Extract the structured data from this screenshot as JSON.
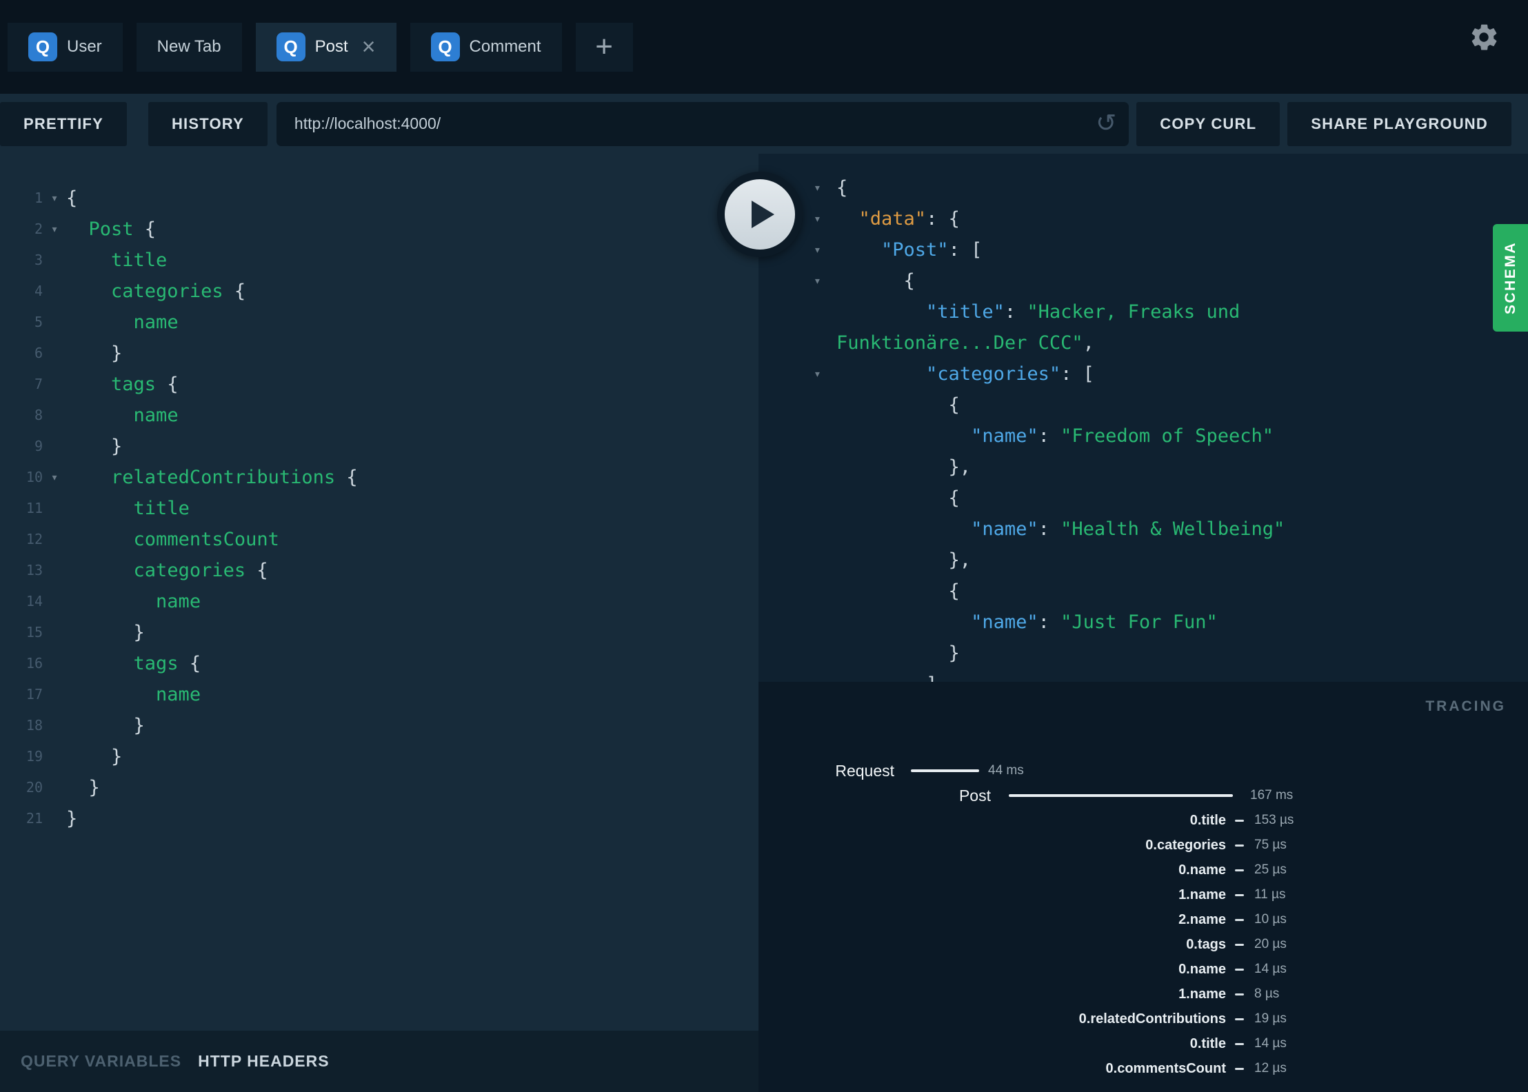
{
  "tabs": {
    "items": [
      {
        "label": "User",
        "type": "query",
        "active": false,
        "closable": false
      },
      {
        "label": "New Tab",
        "type": "plain",
        "active": false,
        "closable": false
      },
      {
        "label": "Post",
        "type": "query",
        "active": true,
        "closable": true
      },
      {
        "label": "Comment",
        "type": "query",
        "active": false,
        "closable": false
      }
    ]
  },
  "icons": {
    "query_badge": "Q",
    "close": "×",
    "plus": "+",
    "reload": "↺",
    "fold": "▾"
  },
  "toolbar": {
    "prettify_label": "PRETTIFY",
    "history_label": "HISTORY",
    "endpoint_value": "http://localhost:4000/",
    "copy_curl_label": "COPY CURL",
    "share_label": "SHARE PLAYGROUND"
  },
  "editor": {
    "lines": [
      {
        "num": 1,
        "fold": true,
        "tokens": [
          [
            "p",
            "{"
          ]
        ]
      },
      {
        "num": 2,
        "fold": true,
        "tokens": [
          [
            "p",
            "  "
          ],
          [
            "f",
            "Post"
          ],
          [
            "p",
            " {"
          ]
        ]
      },
      {
        "num": 3,
        "fold": false,
        "tokens": [
          [
            "p",
            "    "
          ],
          [
            "f",
            "title"
          ]
        ]
      },
      {
        "num": 4,
        "fold": false,
        "tokens": [
          [
            "p",
            "    "
          ],
          [
            "f",
            "categories"
          ],
          [
            "p",
            " {"
          ]
        ]
      },
      {
        "num": 5,
        "fold": false,
        "tokens": [
          [
            "p",
            "      "
          ],
          [
            "f",
            "name"
          ]
        ]
      },
      {
        "num": 6,
        "fold": false,
        "tokens": [
          [
            "p",
            "    }"
          ]
        ]
      },
      {
        "num": 7,
        "fold": false,
        "tokens": [
          [
            "p",
            "    "
          ],
          [
            "f",
            "tags"
          ],
          [
            "p",
            " {"
          ]
        ]
      },
      {
        "num": 8,
        "fold": false,
        "tokens": [
          [
            "p",
            "      "
          ],
          [
            "f",
            "name"
          ]
        ]
      },
      {
        "num": 9,
        "fold": false,
        "tokens": [
          [
            "p",
            "    }"
          ]
        ]
      },
      {
        "num": 10,
        "fold": true,
        "tokens": [
          [
            "p",
            "    "
          ],
          [
            "f",
            "relatedContributions"
          ],
          [
            "p",
            " {"
          ]
        ]
      },
      {
        "num": 11,
        "fold": false,
        "tokens": [
          [
            "p",
            "      "
          ],
          [
            "f",
            "title"
          ]
        ]
      },
      {
        "num": 12,
        "fold": false,
        "tokens": [
          [
            "p",
            "      "
          ],
          [
            "f",
            "commentsCount"
          ]
        ]
      },
      {
        "num": 13,
        "fold": false,
        "tokens": [
          [
            "p",
            "      "
          ],
          [
            "f",
            "categories"
          ],
          [
            "p",
            " {"
          ]
        ]
      },
      {
        "num": 14,
        "fold": false,
        "tokens": [
          [
            "p",
            "        "
          ],
          [
            "f",
            "name"
          ]
        ]
      },
      {
        "num": 15,
        "fold": false,
        "tokens": [
          [
            "p",
            "      }"
          ]
        ]
      },
      {
        "num": 16,
        "fold": false,
        "tokens": [
          [
            "p",
            "      "
          ],
          [
            "f",
            "tags"
          ],
          [
            "p",
            " {"
          ]
        ]
      },
      {
        "num": 17,
        "fold": false,
        "tokens": [
          [
            "p",
            "        "
          ],
          [
            "f",
            "name"
          ]
        ]
      },
      {
        "num": 18,
        "fold": false,
        "tokens": [
          [
            "p",
            "      }"
          ]
        ]
      },
      {
        "num": 19,
        "fold": false,
        "tokens": [
          [
            "p",
            "    }"
          ]
        ]
      },
      {
        "num": 20,
        "fold": false,
        "tokens": [
          [
            "p",
            "  }"
          ]
        ]
      },
      {
        "num": 21,
        "fold": false,
        "tokens": [
          [
            "p",
            "}"
          ]
        ]
      }
    ]
  },
  "response": {
    "lines": [
      {
        "fold": true,
        "tokens": [
          [
            "p",
            "{"
          ]
        ]
      },
      {
        "fold": true,
        "tokens": [
          [
            "p",
            "  "
          ],
          [
            "kd",
            "\"data\""
          ],
          [
            "p",
            ": {"
          ]
        ]
      },
      {
        "fold": true,
        "tokens": [
          [
            "p",
            "    "
          ],
          [
            "k",
            "\"Post\""
          ],
          [
            "p",
            ": ["
          ]
        ]
      },
      {
        "fold": true,
        "tokens": [
          [
            "p",
            "      {"
          ]
        ]
      },
      {
        "fold": false,
        "tokens": [
          [
            "p",
            "        "
          ],
          [
            "k",
            "\"title\""
          ],
          [
            "p",
            ": "
          ],
          [
            "s",
            "\"Hacker, Freaks und"
          ]
        ]
      },
      {
        "fold": false,
        "tokens": [
          [
            "s",
            "Funktionäre...Der CCC\""
          ],
          [
            "p",
            ","
          ]
        ]
      },
      {
        "fold": true,
        "tokens": [
          [
            "p",
            "        "
          ],
          [
            "k",
            "\"categories\""
          ],
          [
            "p",
            ": ["
          ]
        ]
      },
      {
        "fold": false,
        "tokens": [
          [
            "p",
            "          {"
          ]
        ]
      },
      {
        "fold": false,
        "tokens": [
          [
            "p",
            "            "
          ],
          [
            "k",
            "\"name\""
          ],
          [
            "p",
            ": "
          ],
          [
            "s",
            "\"Freedom of Speech\""
          ]
        ]
      },
      {
        "fold": false,
        "tokens": [
          [
            "p",
            "          },"
          ]
        ]
      },
      {
        "fold": false,
        "tokens": [
          [
            "p",
            "          {"
          ]
        ]
      },
      {
        "fold": false,
        "tokens": [
          [
            "p",
            "            "
          ],
          [
            "k",
            "\"name\""
          ],
          [
            "p",
            ": "
          ],
          [
            "s",
            "\"Health & Wellbeing\""
          ]
        ]
      },
      {
        "fold": false,
        "tokens": [
          [
            "p",
            "          },"
          ]
        ]
      },
      {
        "fold": false,
        "tokens": [
          [
            "p",
            "          {"
          ]
        ]
      },
      {
        "fold": false,
        "tokens": [
          [
            "p",
            "            "
          ],
          [
            "k",
            "\"name\""
          ],
          [
            "p",
            ": "
          ],
          [
            "s",
            "\"Just For Fun\""
          ]
        ]
      },
      {
        "fold": false,
        "tokens": [
          [
            "p",
            "          }"
          ]
        ]
      },
      {
        "fold": false,
        "tokens": [
          [
            "p",
            "        ],"
          ]
        ]
      }
    ]
  },
  "schema_tab": {
    "label": "SCHEMA"
  },
  "tracing": {
    "title": "TRACING",
    "request": {
      "label": "Request",
      "duration": "44 ms"
    },
    "root": {
      "label": "Post",
      "duration": "167 ms"
    },
    "rows": [
      {
        "label": "0.title",
        "duration": "153 µs"
      },
      {
        "label": "0.categories",
        "duration": "75 µs"
      },
      {
        "label": "0.name",
        "duration": "25 µs"
      },
      {
        "label": "1.name",
        "duration": "11 µs"
      },
      {
        "label": "2.name",
        "duration": "10 µs"
      },
      {
        "label": "0.tags",
        "duration": "20 µs"
      },
      {
        "label": "0.name",
        "duration": "14 µs"
      },
      {
        "label": "1.name",
        "duration": "8 µs"
      },
      {
        "label": "0.relatedContributions",
        "duration": "19 µs"
      },
      {
        "label": "0.title",
        "duration": "14 µs"
      },
      {
        "label": "0.commentsCount",
        "duration": "12 µs"
      }
    ]
  },
  "bottom_tabs": {
    "variables_label": "QUERY VARIABLES",
    "headers_label": "HTTP HEADERS"
  },
  "colors": {
    "accent_green": "#29B973",
    "schema_green": "#27AE60",
    "badge_blue": "#2D7ED3",
    "response_key_blue": "#4FA9E8",
    "response_key_orange": "#DE9B43",
    "editor_bg": "#172B3A",
    "result_bg": "#0F2130",
    "tracing_bg": "#0B1926",
    "topbar_bg": "#09141E"
  }
}
